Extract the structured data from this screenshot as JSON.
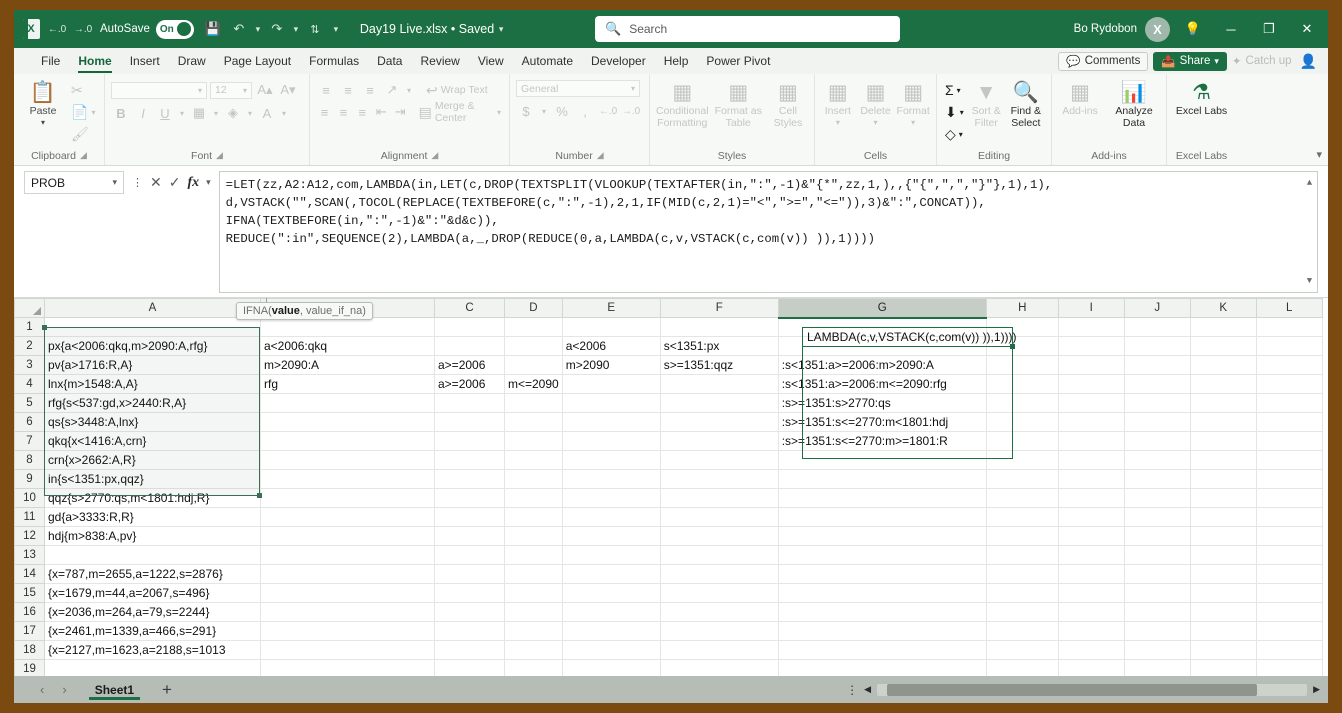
{
  "titlebar": {
    "autosave_label": "AutoSave",
    "autosave_state": "On",
    "doc_title": "Day19 Live.xlsx • Saved",
    "search_placeholder": "Search",
    "search_icon": "search-icon",
    "user_name": "Bo Rydobon",
    "avatar_initial": "X",
    "icons": {
      "excel": "excel-logo-icon",
      "dec_decimal": "decrease-decimal-icon",
      "inc_decimal": "increase-decimal-icon",
      "save": "save-icon",
      "undo": "undo-icon",
      "redo": "redo-icon",
      "sort": "sort-icon",
      "customize": "customize-quick-access-icon",
      "help": "help-lightbulb-icon",
      "minimize": "minimize-icon",
      "restore": "restore-icon",
      "close": "close-icon"
    }
  },
  "ribbon_tabs": {
    "items": [
      {
        "label": "File",
        "active": false
      },
      {
        "label": "Home",
        "active": true
      },
      {
        "label": "Insert",
        "active": false
      },
      {
        "label": "Draw",
        "active": false
      },
      {
        "label": "Page Layout",
        "active": false
      },
      {
        "label": "Formulas",
        "active": false
      },
      {
        "label": "Data",
        "active": false
      },
      {
        "label": "Review",
        "active": false
      },
      {
        "label": "View",
        "active": false
      },
      {
        "label": "Automate",
        "active": false
      },
      {
        "label": "Developer",
        "active": false
      },
      {
        "label": "Help",
        "active": false
      },
      {
        "label": "Power Pivot",
        "active": false
      }
    ],
    "comments_label": "Comments",
    "share_label": "Share",
    "catchup_label": "Catch up"
  },
  "ribbon": {
    "groups": [
      {
        "title": "Clipboard"
      },
      {
        "title": "Font"
      },
      {
        "title": "Alignment"
      },
      {
        "title": "Number"
      },
      {
        "title": "Styles"
      },
      {
        "title": "Cells"
      },
      {
        "title": "Editing"
      },
      {
        "title": "Add-ins"
      },
      {
        "title": "Excel Labs"
      }
    ],
    "clipboard": {
      "paste": "Paste",
      "cut": "cut-icon",
      "copy": "copy-icon",
      "format_painter": "format-painter-icon"
    },
    "font": {
      "font_name": "",
      "font_size": "12",
      "grow": "A",
      "shrink": "A",
      "bold": "B",
      "italic": "I",
      "underline": "U",
      "borders_icon": "borders-icon",
      "fill_icon": "fill-color-icon",
      "font_color_icon": "font-color-icon"
    },
    "alignment": {
      "wrap_text": "Wrap Text",
      "merge_center": "Merge & Center",
      "orientation_icon": "orientation-icon",
      "indent_dec": "decrease-indent-icon",
      "indent_inc": "increase-indent-icon"
    },
    "number": {
      "format": "General",
      "currency": "$",
      "percent": "%",
      "comma": ",",
      "inc_dec": "increase-decimal-icon",
      "dec_dec": "decrease-decimal-icon"
    },
    "styles": {
      "conditional": "Conditional Formatting",
      "table": "Format as Table",
      "cell_styles": "Cell Styles"
    },
    "cells": {
      "insert": "Insert",
      "delete": "Delete",
      "format": "Format"
    },
    "editing": {
      "autosum": "Σ",
      "fill": "fill-down-icon",
      "clear": "clear-icon",
      "sort_filter": "Sort & Filter",
      "find_select": "Find & Select"
    },
    "addins": {
      "label": "Add-ins",
      "analyze": "Analyze Data"
    },
    "excel_labs": {
      "label": "Excel Labs"
    }
  },
  "formula_bar": {
    "name_box": "PROB",
    "cancel_icon": "cancel-icon",
    "enter_icon": "confirm-icon",
    "fx_icon": "insert-function-icon",
    "lines": [
      "=LET(zz,A2:A12,com,LAMBDA(in,LET(c,DROP(TEXTSPLIT(VLOOKUP(TEXTAFTER(in,\":\",-1)&\"{*\",zz,1,),,{\"{\",\",\",\"}\"},1),1),",
      "d,VSTACK(\"\",SCAN(,TOCOL(REPLACE(TEXTBEFORE(c,\":\",-1),2,1,IF(MID(c,2,1)=\"<\",\">=\",\"<=\")),3)&\":\",CONCAT)),",
      "IFNA(TEXTBEFORE(in,\":\",-1)&\":\"&d&c)),",
      "REDUCE(\":in\",SEQUENCE(2),LAMBDA(a,_,DROP(REDUCE(0,a,LAMBDA(c,v,VSTACK(c,com(v)) )),1))))"
    ],
    "reference_token": "A2:A12"
  },
  "tooltip": {
    "function": "IFNA(",
    "arg_active": "value",
    "arg_rest": ", value_if_na)"
  },
  "grid": {
    "columns": [
      "A",
      "B",
      "C",
      "D",
      "E",
      "F",
      "G",
      "H",
      "I",
      "J",
      "K",
      "L"
    ],
    "active_column": "G",
    "row_numbers": [
      1,
      2,
      3,
      4,
      5,
      6,
      7,
      8,
      9,
      10,
      11,
      12,
      13,
      14,
      15,
      16,
      17,
      18,
      19
    ],
    "column_a": {
      "2": "px{a<2006:qkq,m>2090:A,rfg}",
      "3": "pv{a>1716:R,A}",
      "4": "lnx{m>1548:A,A}",
      "5": "rfg{s<537:gd,x>2440:R,A}",
      "6": "qs{s>3448:A,lnx}",
      "7": "qkq{x<1416:A,crn}",
      "8": "crn{x>2662:A,R}",
      "9": "in{s<1351:px,qqz}",
      "10": "qqz{s>2770:qs,m<1801:hdj,R}",
      "11": "gd{a>3333:R,R}",
      "12": "hdj{m>838:A,pv}",
      "14": "{x=787,m=2655,a=1222,s=2876}",
      "15": "{x=1679,m=44,a=2067,s=496}",
      "16": "{x=2036,m=264,a=79,s=2244}",
      "17": "{x=2461,m=1339,a=466,s=291}",
      "18": "{x=2127,m=1623,a=2188,s=1013"
    },
    "column_b": {
      "2": "a<2006:qkq",
      "3": "m>2090:A",
      "4": "rfg"
    },
    "column_c": {
      "3": "a>=2006",
      "4": "a>=2006"
    },
    "column_d": {
      "4": "m<=2090"
    },
    "column_e": {
      "2": "a<2006",
      "3": "m>2090"
    },
    "column_f": {
      "2": "s<1351:px",
      "3": "s>=1351:qqz"
    },
    "column_g": {
      "2": "LAMBDA(c,v,VSTACK(c,com(v)) )),1))))",
      "3": ":s<1351:a>=2006:m>2090:A",
      "4": ":s<1351:a>=2006:m<=2090:rfg",
      "5": ":s>=1351:s>2770:qs",
      "6": ":s>=1351:s<=2770:m<1801:hdj",
      "7": ":s>=1351:s<=2770:m>=1801:R"
    }
  },
  "statusbar": {
    "prev_sheet_icon": "previous-sheet-icon",
    "next_sheet_icon": "next-sheet-icon",
    "sheet_name": "Sheet1",
    "add_sheet_label": "+",
    "scroll_left_icon": "scroll-left-icon",
    "scroll_right_icon": "scroll-right-icon"
  }
}
